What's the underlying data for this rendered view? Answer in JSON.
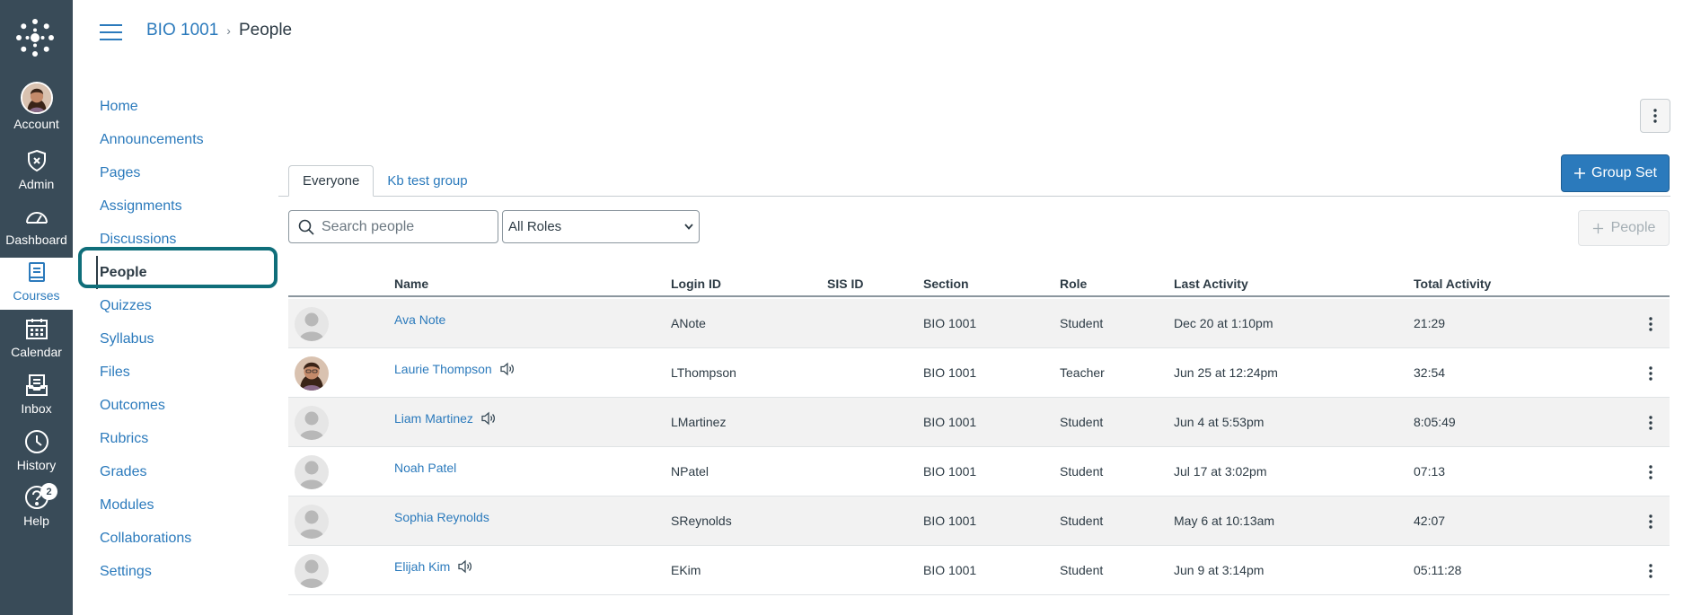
{
  "global_nav": {
    "items": [
      {
        "label": "Account",
        "icon": "avatar"
      },
      {
        "label": "Admin",
        "icon": "shield-icon"
      },
      {
        "label": "Dashboard",
        "icon": "dashboard-icon"
      },
      {
        "label": "Courses",
        "icon": "book-icon"
      },
      {
        "label": "Calendar",
        "icon": "calendar-icon"
      },
      {
        "label": "Inbox",
        "icon": "inbox-icon"
      },
      {
        "label": "History",
        "icon": "clock-icon"
      },
      {
        "label": "Help",
        "icon": "help-icon",
        "badge": "2"
      }
    ],
    "active": "Courses",
    "bg_color": "#394b58"
  },
  "breadcrumb": {
    "course": "BIO 1001",
    "separator": "›",
    "current": "People"
  },
  "course_nav": {
    "items": [
      "Home",
      "Announcements",
      "Pages",
      "Assignments",
      "Discussions",
      "People",
      "Quizzes",
      "Syllabus",
      "Files",
      "Outcomes",
      "Rubrics",
      "Grades",
      "Modules",
      "Collaborations",
      "Settings"
    ],
    "active": "People"
  },
  "tabs": [
    "Everyone",
    "Kb test group"
  ],
  "buttons": {
    "group_set": "Group Set",
    "add_people": "People"
  },
  "search": {
    "placeholder": "Search people",
    "value": ""
  },
  "roles_select": {
    "selected": "All Roles"
  },
  "table": {
    "columns": [
      "Name",
      "Login ID",
      "SIS ID",
      "Section",
      "Role",
      "Last Activity",
      "Total Activity"
    ],
    "rows": [
      {
        "name": "Ava Note",
        "login": "ANote",
        "sis": "",
        "section": "BIO 1001",
        "role": "Student",
        "last": "Dec 20 at 1:10pm",
        "total": "21:29",
        "pronounce": false,
        "photo": false
      },
      {
        "name": "Laurie Thompson",
        "login": "LThompson",
        "sis": "",
        "section": "BIO 1001",
        "role": "Teacher",
        "last": "Jun 25 at 12:24pm",
        "total": "32:54",
        "pronounce": true,
        "photo": true
      },
      {
        "name": "Liam Martinez",
        "login": "LMartinez",
        "sis": "",
        "section": "BIO 1001",
        "role": "Student",
        "last": "Jun 4 at 5:53pm",
        "total": "8:05:49",
        "pronounce": true,
        "photo": false
      },
      {
        "name": "Noah Patel",
        "login": "NPatel",
        "sis": "",
        "section": "BIO 1001",
        "role": "Student",
        "last": "Jul 17 at 3:02pm",
        "total": "07:13",
        "pronounce": false,
        "photo": false
      },
      {
        "name": "Sophia Reynolds",
        "login": "SReynolds",
        "sis": "",
        "section": "BIO 1001",
        "role": "Student",
        "last": "May 6 at 10:13am",
        "total": "42:07",
        "pronounce": false,
        "photo": false
      },
      {
        "name": "Elijah Kim",
        "login": "EKim",
        "sis": "",
        "section": "BIO 1001",
        "role": "Student",
        "last": "Jun 9 at 3:14pm",
        "total": "05:11:28",
        "pronounce": true,
        "photo": false
      }
    ]
  },
  "colors": {
    "link": "#2b7abc",
    "focus_ring": "#0f6e7a",
    "primary_button": "#2b7abc"
  }
}
